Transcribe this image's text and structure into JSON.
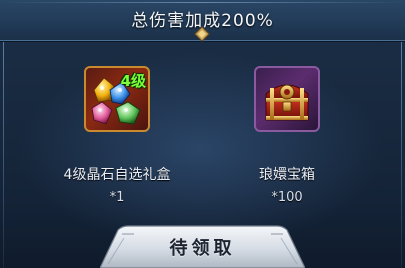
{
  "header": {
    "title": "总伤害加成200%"
  },
  "rewards": [
    {
      "icon": "gem-gift-box-icon",
      "badge": "4级",
      "name": "4级晶石自选礼盒",
      "quantity": "*1"
    },
    {
      "icon": "treasure-chest-icon",
      "name": "琅嬛宝箱",
      "quantity": "*100"
    }
  ],
  "claim": {
    "label": "待领取"
  },
  "colors": {
    "badge_green": "#7cff3a",
    "panel_blue": "#1c2f47",
    "gold_frame": "#c98a2e"
  }
}
